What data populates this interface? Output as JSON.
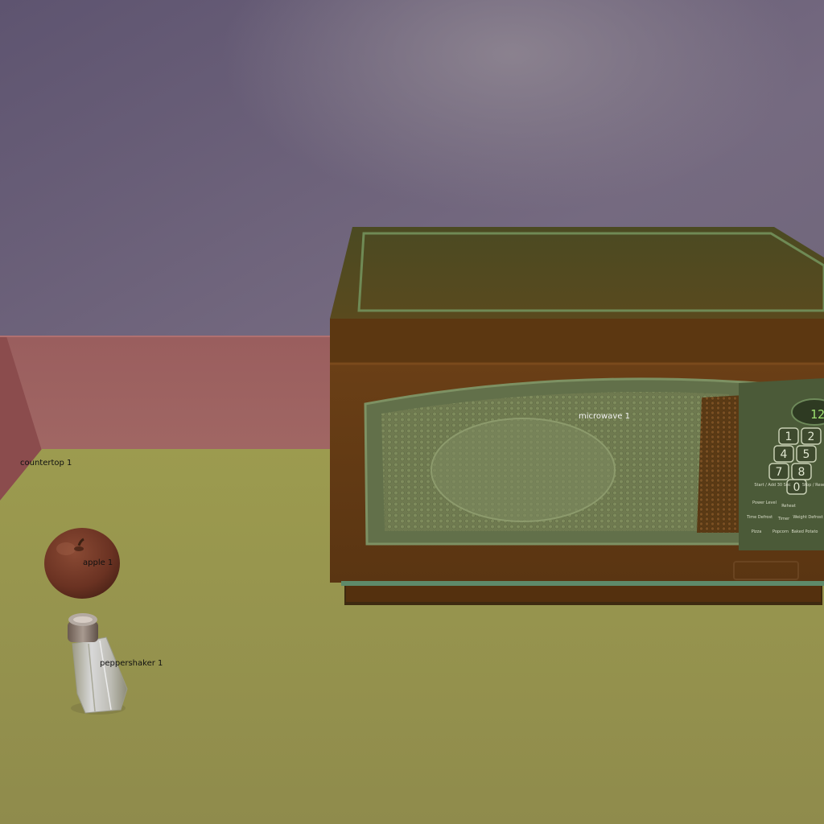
{
  "scene": {
    "objects": [
      {
        "id": "countertop",
        "label": "countertop 1"
      },
      {
        "id": "apple",
        "label": "apple 1"
      },
      {
        "id": "peppershaker",
        "label": "peppershaker 1"
      },
      {
        "id": "microwave",
        "label": "microwave 1"
      }
    ],
    "microwave_keypad": {
      "keys": [
        "1",
        "2",
        "4",
        "5",
        "7",
        "8",
        "0"
      ],
      "display": "12",
      "buttons": [
        "Start / Add 30 Sec",
        "Stop / Reset",
        "Power Level",
        "Reheat",
        "Time Defrost",
        "Timer",
        "Weight Defrost",
        "Pizza",
        "Popcorn",
        "Baked Potato"
      ]
    }
  }
}
